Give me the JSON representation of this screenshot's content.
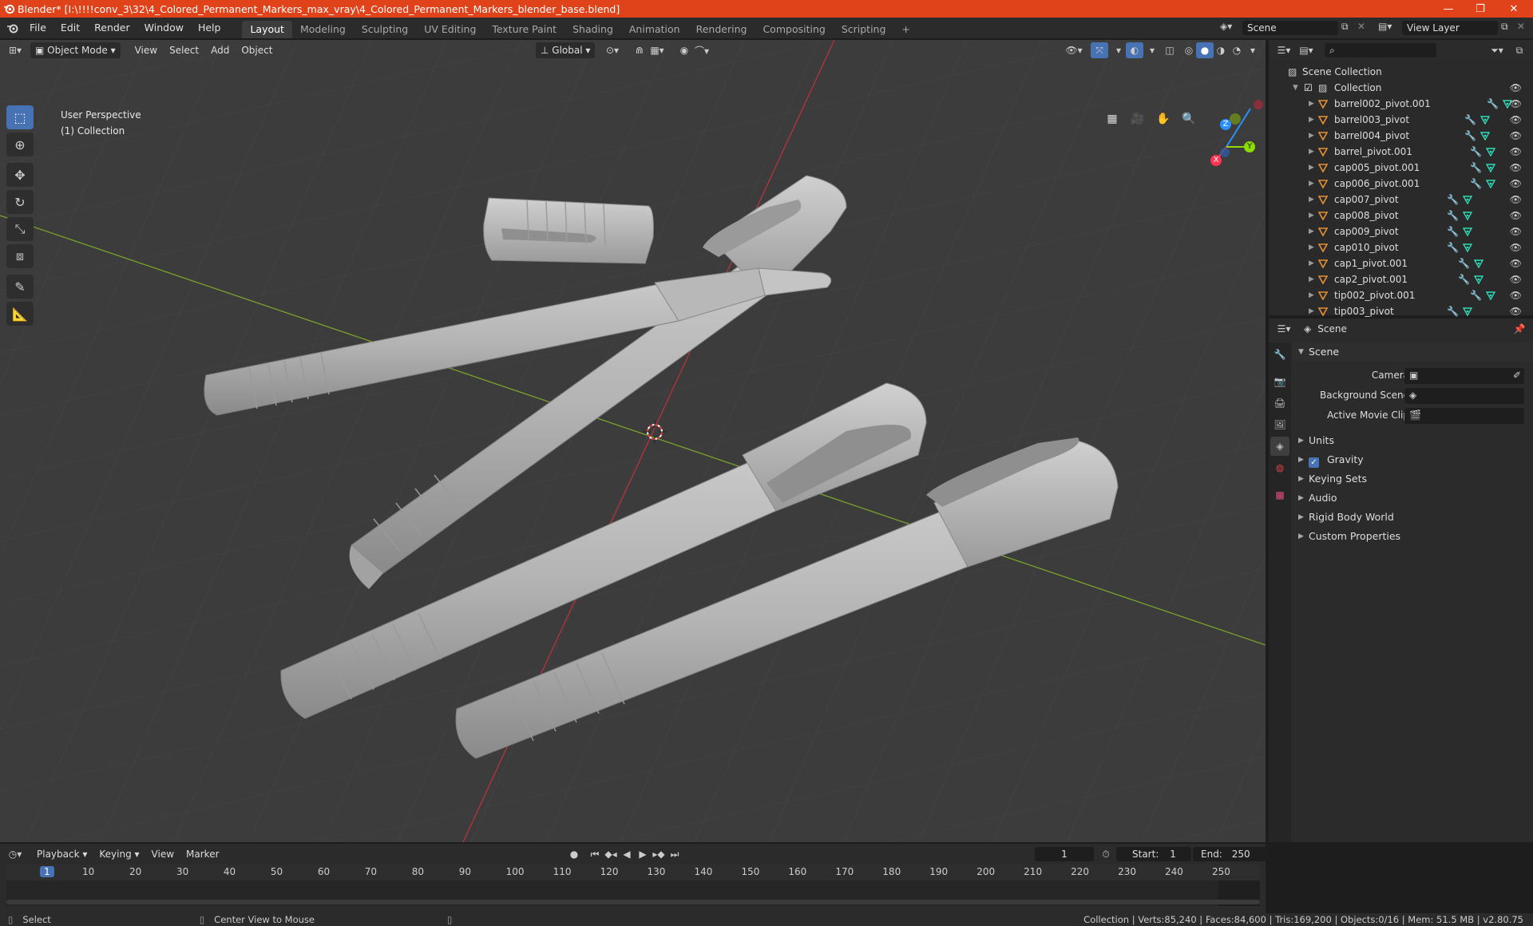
{
  "window": {
    "title": "Blender* [I:\\!!!!conv_3\\32\\4_Colored_Permanent_Markers_max_vray\\4_Colored_Permanent_Markers_blender_base.blend]",
    "minimize": "—",
    "maximize": "❐",
    "close": "✕"
  },
  "menu": [
    "File",
    "Edit",
    "Render",
    "Window",
    "Help"
  ],
  "workspaces": [
    "Layout",
    "Modeling",
    "Sculpting",
    "UV Editing",
    "Texture Paint",
    "Shading",
    "Animation",
    "Rendering",
    "Compositing",
    "Scripting"
  ],
  "active_workspace": "Layout",
  "add_workspace": "+",
  "scene_selector": "Scene",
  "view_layer_selector": "View Layer",
  "viewport": {
    "mode": "Object Mode",
    "menus": [
      "View",
      "Select",
      "Add",
      "Object"
    ],
    "transform_orientation": "Global",
    "info_line1": "User Perspective",
    "info_line2": "(1) Collection",
    "axis_x": "X",
    "axis_y": "Y",
    "axis_z": "Z"
  },
  "outliner": {
    "search_placeholder": "",
    "root": "Scene Collection",
    "collection": "Collection",
    "items": [
      "barrel002_pivot.001",
      "barrel003_pivot",
      "barrel004_pivot",
      "barrel_pivot.001",
      "cap005_pivot.001",
      "cap006_pivot.001",
      "cap007_pivot",
      "cap008_pivot",
      "cap009_pivot",
      "cap010_pivot",
      "cap1_pivot.001",
      "cap2_pivot.001",
      "tip002_pivot.001",
      "tip003_pivot"
    ]
  },
  "properties": {
    "header_context": "Scene",
    "panel_title": "Scene",
    "fields": {
      "camera": "Camera",
      "background_scene": "Background Scene",
      "active_movie_clip": "Active Movie Clip"
    },
    "subpanels": [
      "Units",
      "Gravity",
      "Keying Sets",
      "Audio",
      "Rigid Body World",
      "Custom Properties"
    ],
    "gravity_checked": true
  },
  "timeline": {
    "menus": [
      "Playback",
      "Keying",
      "View",
      "Marker"
    ],
    "current_frame": "1",
    "start_label": "Start:",
    "start_value": "1",
    "end_label": "End:",
    "end_value": "250",
    "ticks": [
      "1",
      "10",
      "20",
      "30",
      "40",
      "50",
      "60",
      "70",
      "80",
      "90",
      "100",
      "110",
      "120",
      "130",
      "140",
      "150",
      "160",
      "170",
      "180",
      "190",
      "200",
      "210",
      "220",
      "230",
      "240",
      "250"
    ]
  },
  "statusbar": {
    "left_action": "Select",
    "middle_action": "Center View to Mouse",
    "stats": "Collection | Verts:85,240 | Faces:84,600 | Tris:169,200 | Objects:0/16 | Mem: 51.5 MB | v2.80.75"
  },
  "colors": {
    "titlebar": "#e0421a",
    "accent_blue": "#4772b3",
    "object_orange": "#e59033",
    "mesh_teal": "#30d9b6",
    "axis_x_red": "#ff3352",
    "axis_y_green": "#8bdc00",
    "axis_z_blue": "#2890ff"
  }
}
